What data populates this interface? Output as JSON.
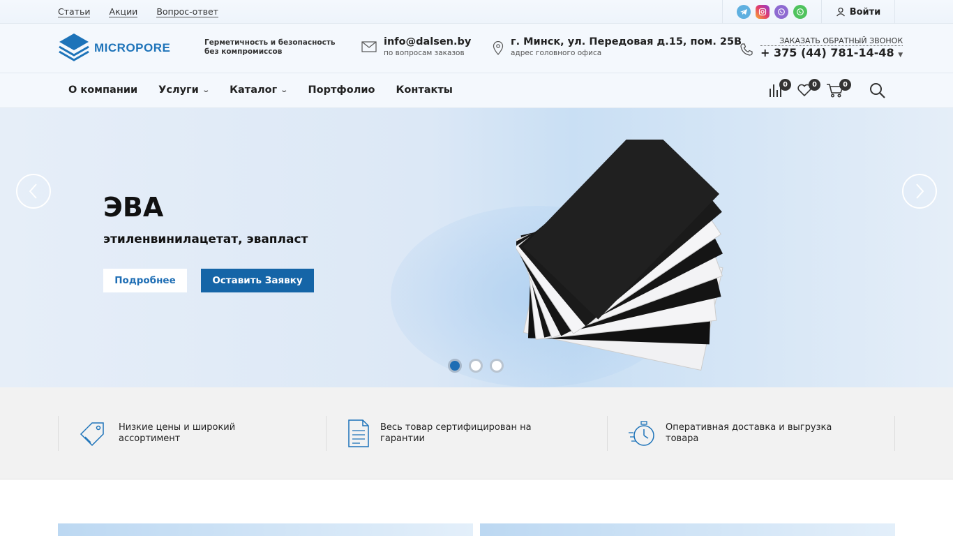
{
  "topbar": {
    "links": [
      "Статьи",
      "Акции",
      "Вопрос-ответ"
    ],
    "socials": [
      "telegram-icon",
      "instagram-icon",
      "viber-icon",
      "whatsapp-icon"
    ],
    "login_label": "Войти"
  },
  "header": {
    "logo_text": "MICROPORE",
    "slogan_line1": "Герметичность и безопасность",
    "slogan_line2": "без компромиссов",
    "email": "info@dalsen.by",
    "email_note": "по вопросам заказов",
    "address": "г. Минск, ул. Передовая д.15, пом. 25В",
    "address_note": "адрес головного офиса",
    "callback_label": "ЗАКАЗАТЬ ОБРАТНЫЙ ЗВОНОК",
    "phone": "+ 375 (44) 781-14-48"
  },
  "nav": {
    "items": [
      {
        "label": "О компании",
        "has_dropdown": false
      },
      {
        "label": "Услуги",
        "has_dropdown": true
      },
      {
        "label": "Каталог",
        "has_dropdown": true
      },
      {
        "label": "Портфолио",
        "has_dropdown": false
      },
      {
        "label": "Контакты",
        "has_dropdown": false
      }
    ],
    "compare_count": "0",
    "favorites_count": "0",
    "cart_count": "0"
  },
  "hero": {
    "title": "ЭВА",
    "subtitle": "этиленвинилацетат, эвапласт",
    "more_label": "Подробнее",
    "order_label": "Оставить Заявку",
    "slides_total": 3,
    "active_slide": 1
  },
  "features": [
    {
      "icon": "price-tag-icon",
      "line1": "Низкие цены и широкий",
      "line2": "ассортимент"
    },
    {
      "icon": "document-icon",
      "line1": "Весь товар сертифицирован на",
      "line2": "гарантии"
    },
    {
      "icon": "stopwatch-icon",
      "line1": "Оперативная доставка и выгрузка",
      "line2": "товара"
    }
  ],
  "colors": {
    "brand": "#1d73b9",
    "button_primary": "#1565a7",
    "badge": "#333333"
  }
}
